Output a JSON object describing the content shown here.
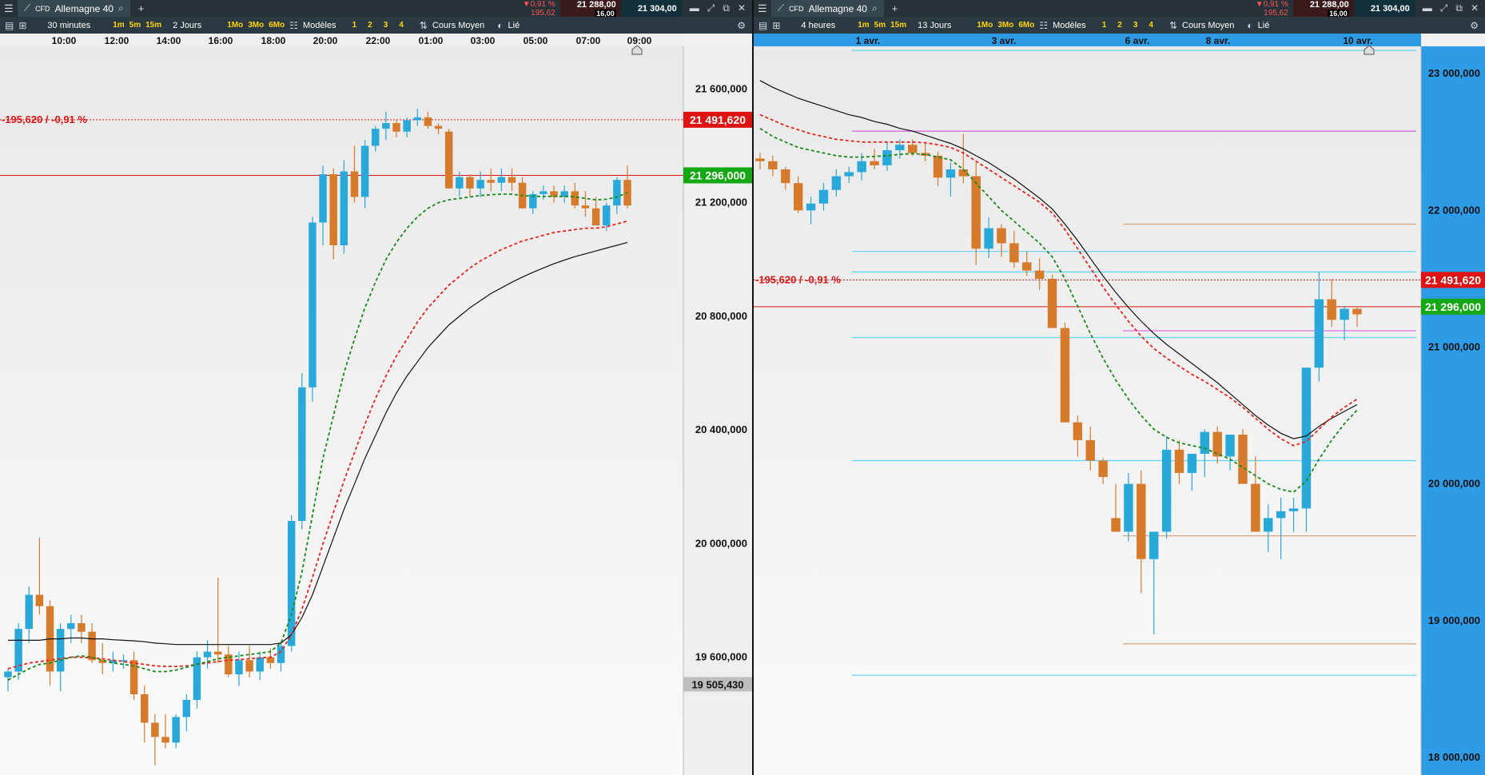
{
  "colors": {
    "up": "#29a9d9",
    "down": "#d67a2c",
    "ema_fast": "#1a8a1a",
    "ema_mid": "#e5251e",
    "sma": "#111111",
    "price_green": "#14a914",
    "price_red": "#e01313",
    "cyan_level": "#5fd3f5",
    "magenta_level": "#e060e0",
    "tan_level": "#d9a47a"
  },
  "left": {
    "symbol_tag": "CFD",
    "symbol": "Allemagne 40",
    "change_pct": "▼0,91 %",
    "change_abs": "195,62",
    "bid": "21 288,00",
    "ask": "21 304,00",
    "spread": "16,00",
    "interval": "30 minutes",
    "range": "2 Jours",
    "btn_1m": "1m",
    "btn_5m": "5m",
    "btn_15m": "15m",
    "btn_1mo": "1Mo",
    "btn_3mo": "3Mo",
    "btn_6mo": "6Mo",
    "models": "Modèles",
    "n1": "1",
    "n2": "2",
    "n3": "3",
    "n4": "4",
    "price_type": "Cours Moyen",
    "link": "Lié",
    "x_labels": [
      "10:00",
      "12:00",
      "14:00",
      "16:00",
      "18:00",
      "20:00",
      "22:00",
      "01:00",
      "03:00",
      "05:00",
      "07:00",
      "09:00"
    ],
    "change_label": "-195,620 / -0,91 %",
    "price_label_red": "21 491,620",
    "price_label_green": "21 296,000",
    "price_label_low": "19 505,430"
  },
  "right": {
    "symbol_tag": "CFD",
    "symbol": "Allemagne 40",
    "change_pct": "▼0,91 %",
    "change_abs": "195,62",
    "bid": "21 288,00",
    "ask": "21 304,00",
    "spread": "16,00",
    "interval": "4 heures",
    "range": "13 Jours",
    "btn_1m": "1m",
    "btn_5m": "5m",
    "btn_15m": "15m",
    "btn_1mo": "1Mo",
    "btn_3mo": "3Mo",
    "btn_6mo": "6Mo",
    "models": "Modèles",
    "n1": "1",
    "n2": "2",
    "n3": "3",
    "n4": "4",
    "price_type": "Cours Moyen",
    "link": "Lié",
    "x_labels": [
      "1 avr.",
      "3 avr.",
      "6 avr.",
      "8 avr.",
      "10 avr."
    ],
    "change_label": "-195,620 / -0,91 %",
    "price_label_red": "21 491,620",
    "price_label_green": "21 296,000"
  },
  "chart_data": [
    {
      "type": "candlestick",
      "x": [
        "10:00",
        "12:00",
        "14:00",
        "16:00",
        "18:00",
        "20:00",
        "22:00",
        "01:00",
        "03:00",
        "05:00",
        "07:00",
        "09:00"
      ],
      "y_ticks": [
        "21 600,000",
        "21 200,000",
        "20 800,000",
        "20 400,000",
        "20 000,000",
        "19 600,000"
      ],
      "ylim": [
        19200,
        21750
      ],
      "y_tick_values": [
        21600,
        21200,
        20800,
        20400,
        20000,
        19600
      ],
      "levels": {
        "current": 21296,
        "previous_close": 21491.62,
        "low_marker": 19505.43
      },
      "ohlc": [
        [
          19530,
          19560,
          19480,
          19550
        ],
        [
          19550,
          19720,
          19520,
          19700
        ],
        [
          19700,
          19850,
          19650,
          19820
        ],
        [
          19820,
          20020,
          19750,
          19780
        ],
        [
          19780,
          19800,
          19500,
          19550
        ],
        [
          19550,
          19720,
          19480,
          19700
        ],
        [
          19700,
          19750,
          19650,
          19720
        ],
        [
          19720,
          19750,
          19650,
          19690
        ],
        [
          19690,
          19720,
          19580,
          19590
        ],
        [
          19590,
          19650,
          19540,
          19580
        ],
        [
          19580,
          19620,
          19550,
          19590
        ],
        [
          19590,
          19610,
          19560,
          19590
        ],
        [
          19590,
          19620,
          19450,
          19470
        ],
        [
          19470,
          19500,
          19300,
          19370
        ],
        [
          19370,
          19400,
          19220,
          19320
        ],
        [
          19320,
          19400,
          19280,
          19300
        ],
        [
          19300,
          19400,
          19280,
          19390
        ],
        [
          19390,
          19470,
          19340,
          19450
        ],
        [
          19450,
          19620,
          19420,
          19600
        ],
        [
          19600,
          19660,
          19560,
          19620
        ],
        [
          19620,
          19880,
          19580,
          19610
        ],
        [
          19610,
          19640,
          19530,
          19540
        ],
        [
          19540,
          19620,
          19500,
          19590
        ],
        [
          19590,
          19640,
          19530,
          19550
        ],
        [
          19550,
          19620,
          19520,
          19600
        ],
        [
          19600,
          19630,
          19560,
          19580
        ],
        [
          19580,
          19650,
          19550,
          19640
        ],
        [
          19640,
          20100,
          19620,
          20080
        ],
        [
          20080,
          20600,
          20050,
          20550
        ],
        [
          20550,
          21150,
          20500,
          21130
        ],
        [
          21130,
          21330,
          21050,
          21300
        ],
        [
          21300,
          21320,
          21000,
          21050
        ],
        [
          21050,
          21350,
          21020,
          21310
        ],
        [
          21310,
          21400,
          21200,
          21220
        ],
        [
          21220,
          21420,
          21180,
          21400
        ],
        [
          21400,
          21470,
          21380,
          21460
        ],
        [
          21460,
          21520,
          21420,
          21480
        ],
        [
          21480,
          21490,
          21430,
          21450
        ],
        [
          21450,
          21500,
          21430,
          21490
        ],
        [
          21490,
          21530,
          21470,
          21500
        ],
        [
          21500,
          21520,
          21460,
          21470
        ],
        [
          21470,
          21480,
          21440,
          21460
        ],
        [
          21450,
          21460,
          21300,
          21250
        ],
        [
          21250,
          21310,
          21220,
          21290
        ],
        [
          21290,
          21300,
          21220,
          21250
        ],
        [
          21250,
          21310,
          21220,
          21280
        ],
        [
          21280,
          21320,
          21240,
          21270
        ],
        [
          21270,
          21320,
          21240,
          21290
        ],
        [
          21290,
          21320,
          21240,
          21270
        ],
        [
          21270,
          21290,
          21180,
          21180
        ],
        [
          21180,
          21240,
          21160,
          21230
        ],
        [
          21230,
          21260,
          21210,
          21240
        ],
        [
          21240,
          21260,
          21200,
          21220
        ],
        [
          21220,
          21260,
          21200,
          21240
        ],
        [
          21240,
          21270,
          21180,
          21190
        ],
        [
          21190,
          21240,
          21150,
          21180
        ],
        [
          21180,
          21220,
          21120,
          21120
        ],
        [
          21120,
          21200,
          21100,
          21190
        ],
        [
          21190,
          21290,
          21160,
          21280
        ],
        [
          21280,
          21330,
          21180,
          21190
        ]
      ],
      "ema_fast": [
        19520,
        19540,
        19560,
        19575,
        19580,
        19590,
        19600,
        19605,
        19600,
        19590,
        19580,
        19575,
        19570,
        19560,
        19550,
        19550,
        19555,
        19565,
        19575,
        19585,
        19595,
        19600,
        19605,
        19610,
        19615,
        19620,
        19650,
        19750,
        19900,
        20100,
        20300,
        20450,
        20600,
        20720,
        20830,
        20920,
        21000,
        21060,
        21110,
        21150,
        21180,
        21200,
        21210,
        21215,
        21220,
        21225,
        21228,
        21230,
        21230,
        21225,
        21222,
        21222,
        21222,
        21222,
        21220,
        21215,
        21210,
        21212,
        21220,
        21235
      ],
      "ema_mid": [
        19560,
        19570,
        19580,
        19585,
        19590,
        19595,
        19600,
        19600,
        19598,
        19595,
        19590,
        19585,
        19580,
        19575,
        19570,
        19568,
        19568,
        19570,
        19575,
        19580,
        19585,
        19590,
        19592,
        19595,
        19598,
        19600,
        19620,
        19680,
        19770,
        19880,
        20000,
        20110,
        20220,
        20320,
        20420,
        20510,
        20590,
        20660,
        20720,
        20780,
        20830,
        20870,
        20910,
        20940,
        20970,
        20995,
        21015,
        21035,
        21050,
        21065,
        21075,
        21085,
        21095,
        21100,
        21105,
        21110,
        21110,
        21115,
        21125,
        21135
      ],
      "sma": [
        19660,
        19660,
        19660,
        19660,
        19665,
        19665,
        19668,
        19668,
        19665,
        19665,
        19662,
        19660,
        19658,
        19655,
        19650,
        19648,
        19645,
        19645,
        19645,
        19645,
        19645,
        19645,
        19645,
        19645,
        19645,
        19645,
        19650,
        19680,
        19740,
        19820,
        19920,
        20020,
        20120,
        20210,
        20300,
        20380,
        20460,
        20530,
        20590,
        20640,
        20690,
        20730,
        20770,
        20800,
        20830,
        20855,
        20880,
        20900,
        20920,
        20938,
        20955,
        20970,
        20985,
        20998,
        21010,
        21020,
        21030,
        21040,
        21050,
        21060
      ]
    },
    {
      "type": "candlestick",
      "x": [
        "1 avr.",
        "3 avr.",
        "6 avr.",
        "8 avr.",
        "10 avr."
      ],
      "y_ticks": [
        "23 000,000",
        "22 000,000",
        "21 000,000",
        "20 000,000",
        "19 000,000",
        "18 000,000"
      ],
      "ylim": [
        17900,
        23200
      ],
      "y_tick_values": [
        23000,
        22000,
        21000,
        20000,
        19000,
        18000
      ],
      "levels": {
        "current": 21296,
        "previous_close": 21491.62,
        "horizontal": [
          23170,
          22580,
          21700,
          21550,
          21070,
          20170,
          18600
        ],
        "tan": [
          21900,
          19620,
          18830
        ],
        "magenta": [
          22580,
          21120
        ]
      },
      "ohlc": [
        [
          22380,
          22420,
          22300,
          22360
        ],
        [
          22360,
          22400,
          22250,
          22300
        ],
        [
          22300,
          22320,
          22150,
          22200
        ],
        [
          22200,
          22250,
          21980,
          22000
        ],
        [
          22000,
          22100,
          21900,
          22050
        ],
        [
          22050,
          22200,
          22000,
          22150
        ],
        [
          22150,
          22300,
          22100,
          22250
        ],
        [
          22250,
          22320,
          22200,
          22280
        ],
        [
          22280,
          22420,
          22220,
          22360
        ],
        [
          22360,
          22450,
          22300,
          22330
        ],
        [
          22330,
          22500,
          22290,
          22440
        ],
        [
          22440,
          22520,
          22380,
          22480
        ],
        [
          22480,
          22520,
          22400,
          22420
        ],
        [
          22420,
          22500,
          22360,
          22400
        ],
        [
          22400,
          22430,
          22180,
          22240
        ],
        [
          22240,
          22350,
          22100,
          22300
        ],
        [
          22300,
          22560,
          22200,
          22250
        ],
        [
          22250,
          22350,
          21600,
          21720
        ],
        [
          21720,
          21950,
          21650,
          21870
        ],
        [
          21870,
          21900,
          21660,
          21760
        ],
        [
          21760,
          21850,
          21580,
          21620
        ],
        [
          21620,
          21700,
          21520,
          21560
        ],
        [
          21560,
          21650,
          21420,
          21500
        ],
        [
          21500,
          21530,
          21150,
          21140
        ],
        [
          21140,
          21180,
          20500,
          20450
        ],
        [
          20450,
          20500,
          20200,
          20320
        ],
        [
          20320,
          20420,
          20100,
          20170
        ],
        [
          20170,
          20190,
          20000,
          20050
        ],
        [
          19750,
          20000,
          19700,
          19650
        ],
        [
          19650,
          20080,
          19580,
          20000
        ],
        [
          20000,
          20100,
          19200,
          19450
        ],
        [
          19450,
          19600,
          18900,
          19650
        ],
        [
          19650,
          20350,
          19600,
          20250
        ],
        [
          20250,
          20320,
          20000,
          20080
        ],
        [
          20080,
          20200,
          19950,
          20220
        ],
        [
          20220,
          20400,
          20050,
          20380
        ],
        [
          20380,
          20420,
          20150,
          20200
        ],
        [
          20200,
          20350,
          20100,
          20360
        ],
        [
          20360,
          20400,
          20000,
          20000
        ],
        [
          20000,
          20200,
          19700,
          19650
        ],
        [
          19650,
          19850,
          19500,
          19750
        ],
        [
          19750,
          19900,
          19450,
          19800
        ],
        [
          19800,
          19900,
          19650,
          19820
        ],
        [
          19820,
          20800,
          19650,
          20850
        ],
        [
          20850,
          21550,
          20750,
          21350
        ],
        [
          21350,
          21500,
          21150,
          21200
        ],
        [
          21200,
          21300,
          21050,
          21280
        ],
        [
          21280,
          21300,
          21150,
          21240
        ]
      ],
      "ema_fast": [
        22600,
        22540,
        22500,
        22460,
        22440,
        22420,
        22400,
        22390,
        22390,
        22395,
        22400,
        22410,
        22415,
        22410,
        22390,
        22370,
        22300,
        22200,
        22100,
        22000,
        21920,
        21840,
        21760,
        21660,
        21500,
        21300,
        21100,
        20920,
        20760,
        20620,
        20500,
        20400,
        20340,
        20300,
        20280,
        20260,
        20220,
        20180,
        20120,
        20060,
        20000,
        19960,
        19940,
        20020,
        20180,
        20320,
        20440,
        20540
      ],
      "ema_mid": [
        22700,
        22660,
        22620,
        22590,
        22560,
        22540,
        22520,
        22510,
        22500,
        22500,
        22500,
        22500,
        22500,
        22495,
        22480,
        22460,
        22420,
        22360,
        22300,
        22240,
        22180,
        22120,
        22060,
        21980,
        21860,
        21720,
        21580,
        21440,
        21310,
        21190,
        21080,
        20990,
        20920,
        20860,
        20800,
        20750,
        20690,
        20630,
        20560,
        20480,
        20400,
        20330,
        20280,
        20310,
        20400,
        20490,
        20560,
        20620
      ],
      "sma": [
        22950,
        22900,
        22860,
        22820,
        22790,
        22760,
        22730,
        22700,
        22680,
        22650,
        22630,
        22600,
        22580,
        22550,
        22520,
        22490,
        22450,
        22400,
        22350,
        22290,
        22230,
        22160,
        22090,
        22010,
        21900,
        21780,
        21650,
        21520,
        21400,
        21290,
        21190,
        21100,
        21020,
        20950,
        20880,
        20810,
        20740,
        20660,
        20580,
        20500,
        20430,
        20370,
        20330,
        20350,
        20420,
        20480,
        20530,
        20580
      ]
    }
  ]
}
